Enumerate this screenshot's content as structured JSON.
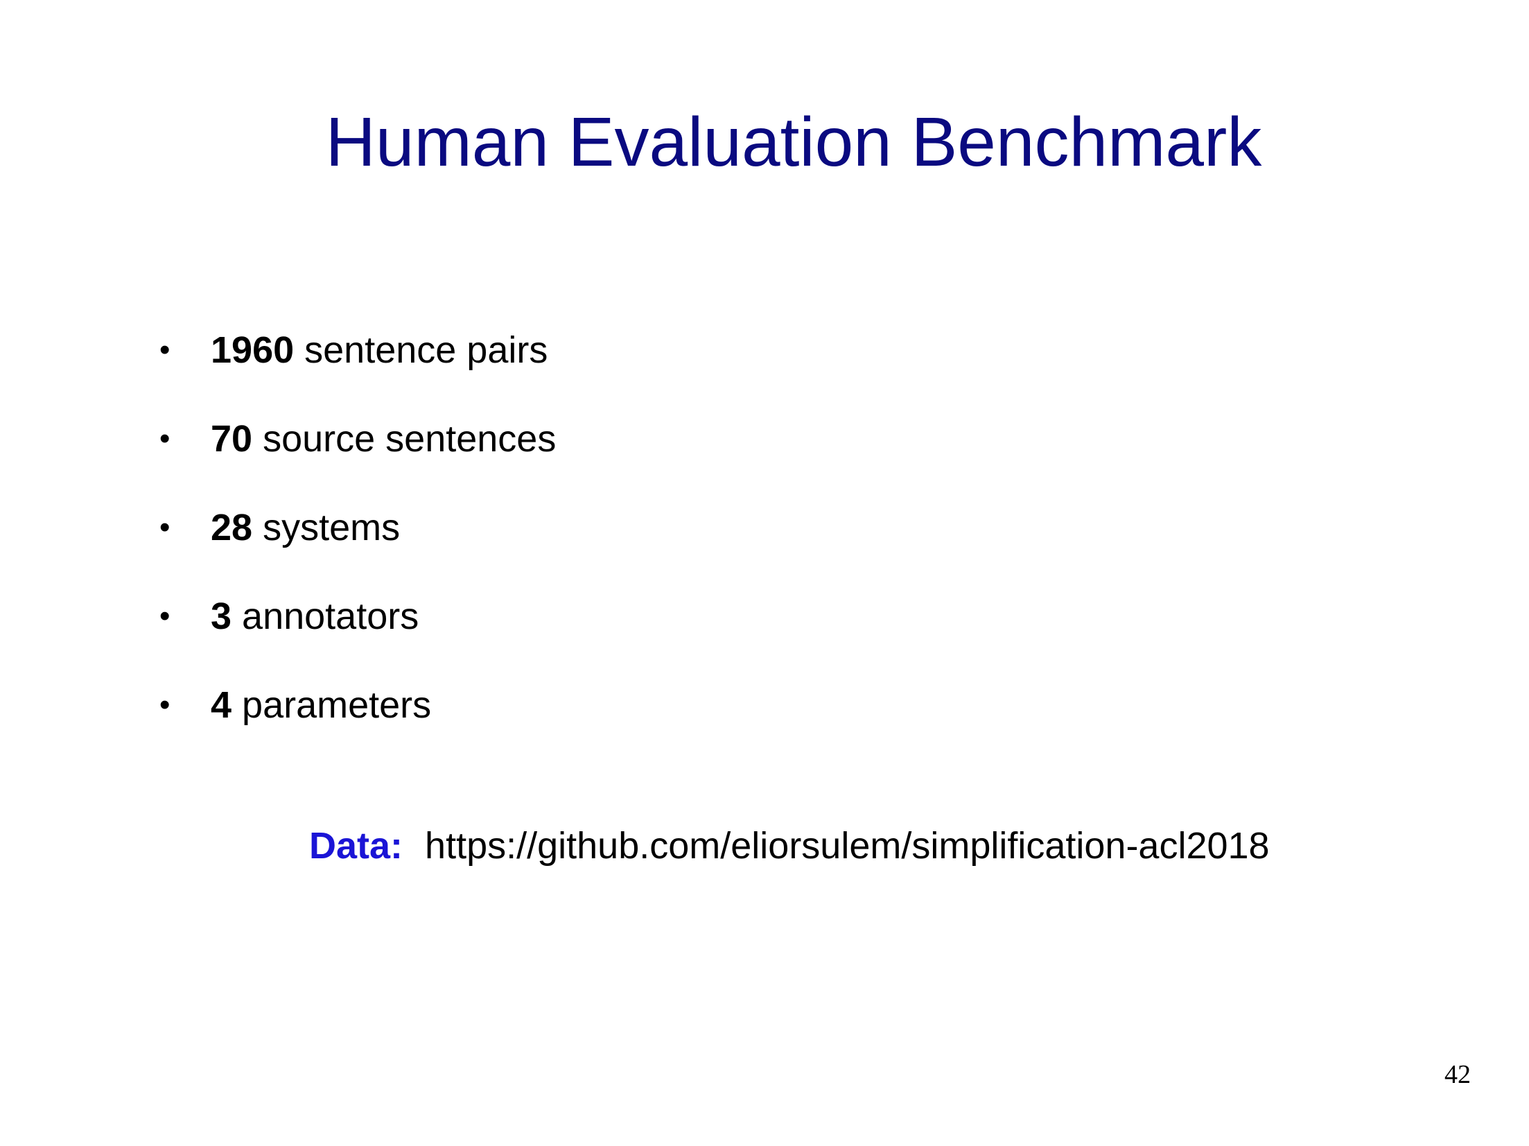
{
  "slide": {
    "title": "Human Evaluation Benchmark",
    "bullet_glyph": "•",
    "bullets": [
      {
        "number": "1960",
        "text": " sentence pairs"
      },
      {
        "number": "70",
        "text": " source sentences"
      },
      {
        "number": "28",
        "text": " systems"
      },
      {
        "number": "3",
        "text": " annotators"
      },
      {
        "number": "4",
        "text": " parameters"
      }
    ],
    "data_label": "Data:",
    "data_url": "https://github.com/eliorsulem/simplification-acl2018",
    "page_number": "42"
  },
  "colors": {
    "title": "#0a0a80",
    "data_label": "#1a14d6",
    "text": "#000000",
    "background": "#ffffff"
  }
}
